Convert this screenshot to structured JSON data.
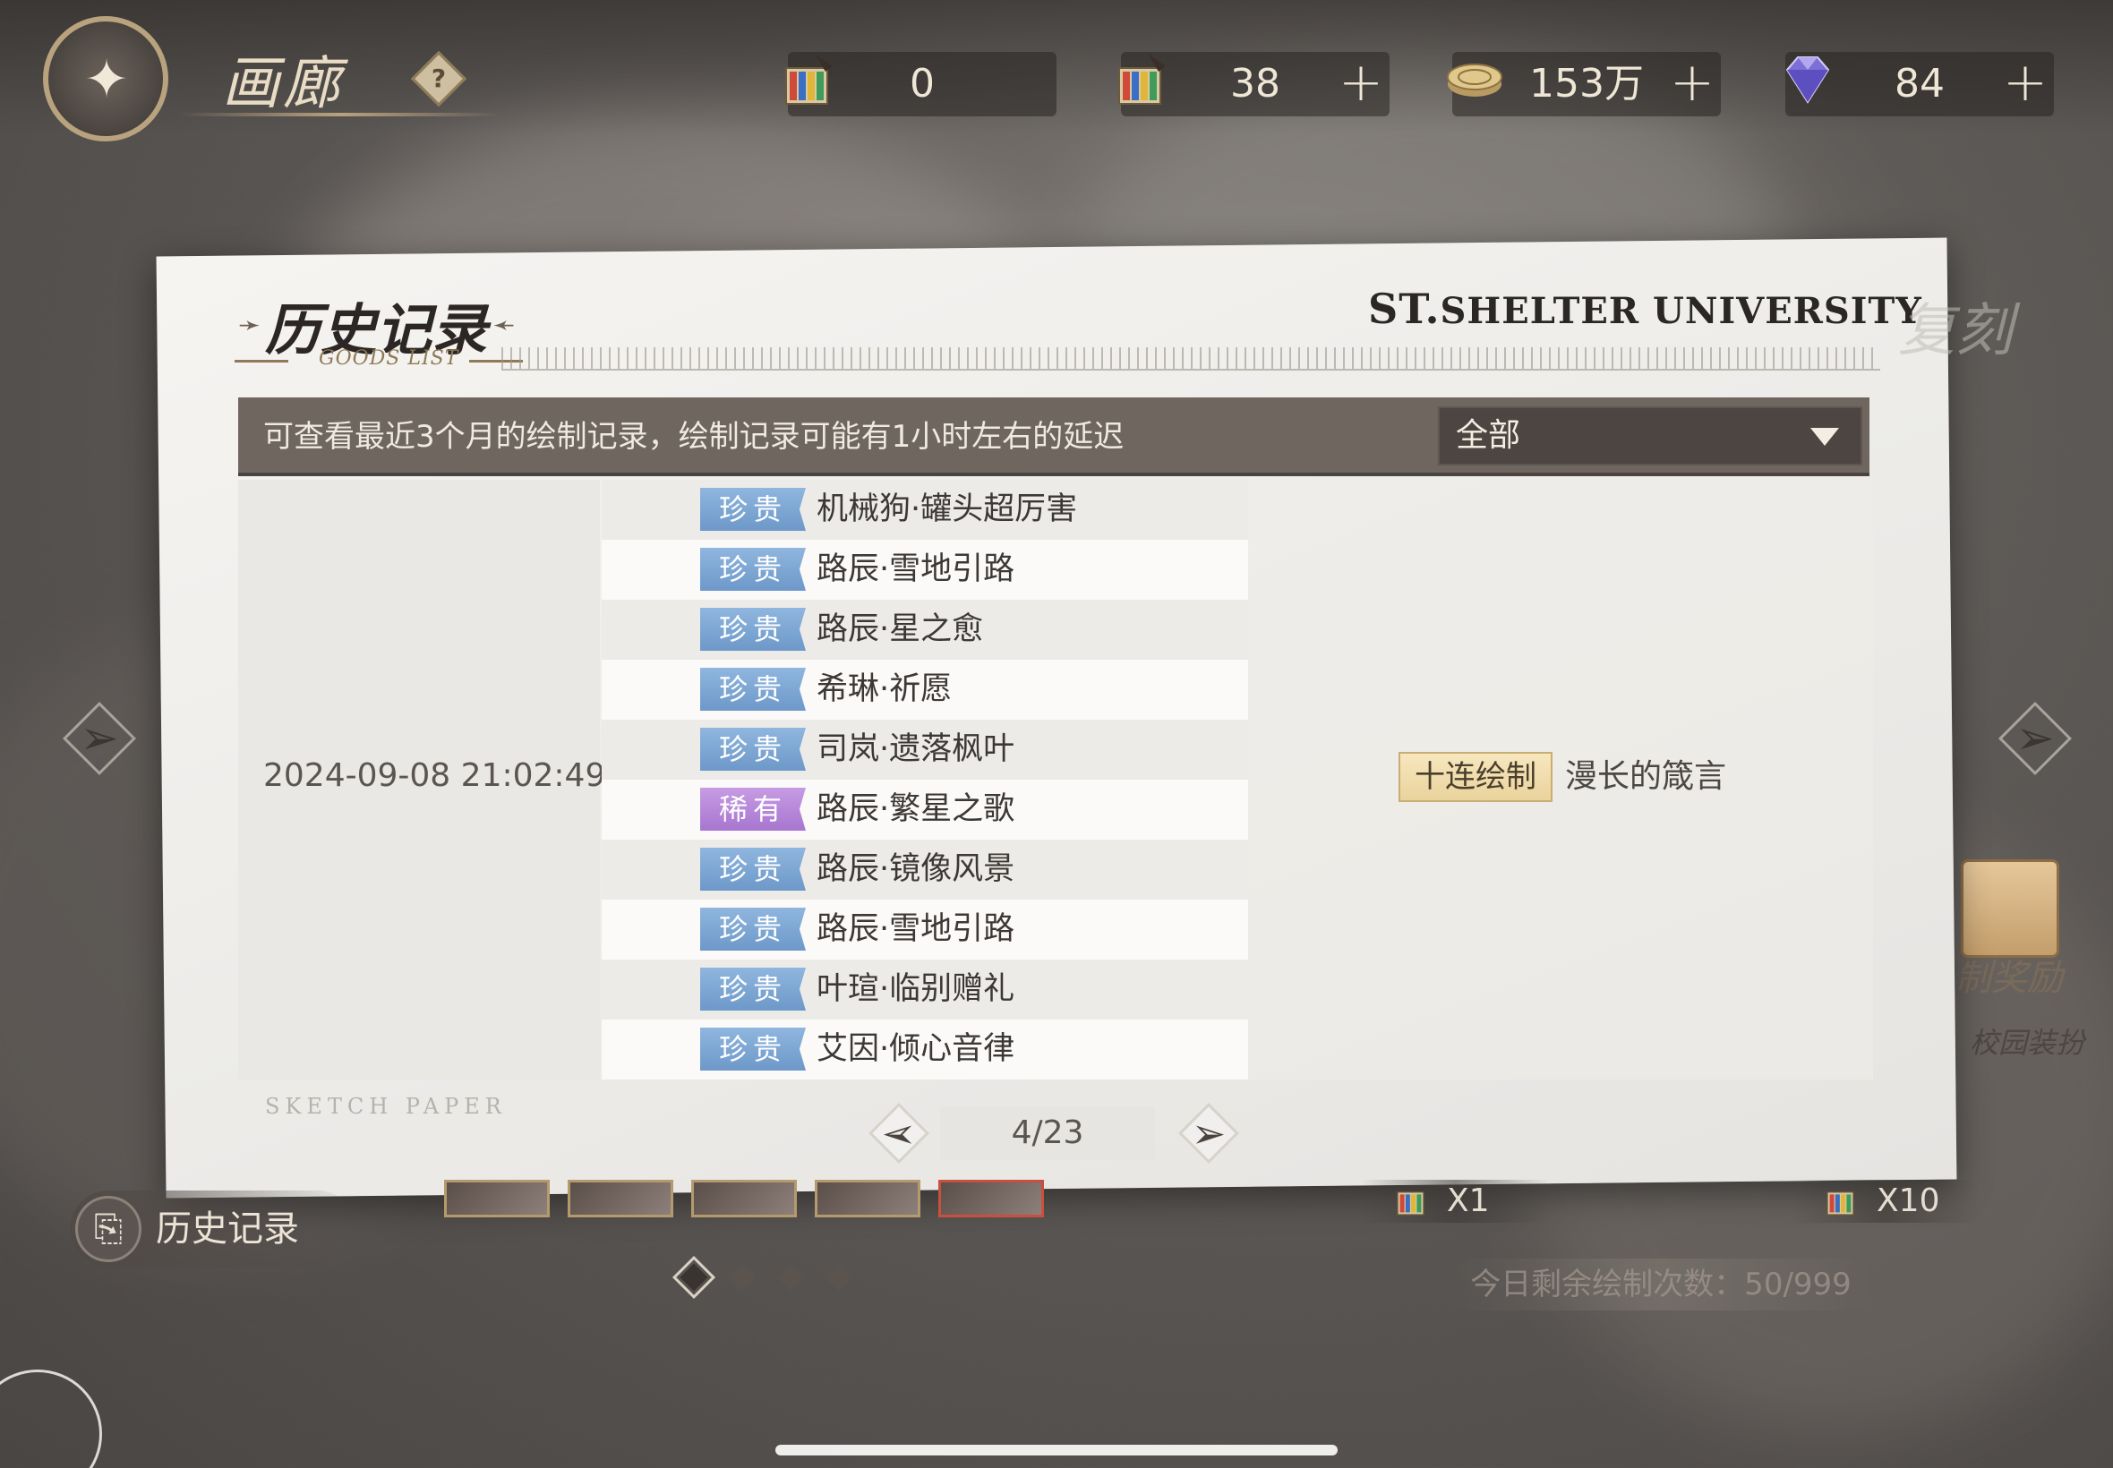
{
  "header": {
    "title": "画廊",
    "help_symbol": "?"
  },
  "resources": [
    {
      "icon": "paint-ticket-icon",
      "value": "0",
      "has_plus": false
    },
    {
      "icon": "paint-ticket-icon",
      "value": "38",
      "has_plus": true
    },
    {
      "icon": "coin-icon",
      "value": "153万",
      "has_plus": true
    },
    {
      "icon": "diamond-gem-icon",
      "value": "84",
      "has_plus": true
    }
  ],
  "modal": {
    "title": "历史记录",
    "subtitle": "GOODS LIST",
    "brand_prefix": "ST.",
    "brand": "SHELTER UNIVERSITY",
    "watermark": "复刻",
    "notice": "可查看最近3个月的绘制记录，绘制记录可能有1小时左右的延迟",
    "filter_value": "全部",
    "sketch_label": "SKETCH PAPER",
    "pagination": "4/23",
    "record": {
      "datetime": "2024-09-08  21:02:49",
      "draw_type": "十连绘制",
      "pool_name": "漫长的箴言",
      "items": [
        {
          "rarity": "珍贵",
          "name": "机械狗·罐头超厉害"
        },
        {
          "rarity": "珍贵",
          "name": "路辰·雪地引路"
        },
        {
          "rarity": "珍贵",
          "name": "路辰·星之愈"
        },
        {
          "rarity": "珍贵",
          "name": "希琳·祈愿"
        },
        {
          "rarity": "珍贵",
          "name": "司岚·遗落枫叶"
        },
        {
          "rarity": "稀有",
          "name": "路辰·繁星之歌"
        },
        {
          "rarity": "珍贵",
          "name": "路辰·镜像风景"
        },
        {
          "rarity": "珍贵",
          "name": "路辰·雪地引路"
        },
        {
          "rarity": "珍贵",
          "name": "叶瑄·临别赠礼"
        },
        {
          "rarity": "珍贵",
          "name": "艾因·倾心音律"
        }
      ]
    }
  },
  "footer": {
    "history_button": "历史记录",
    "draw_once": "X1",
    "draw_ten": "X10",
    "remaining": "今日剩余绘制次数：50/999",
    "reward_text1": "制奖励",
    "reward_text2": "校园装扮"
  },
  "colors": {
    "rarity_precious": "#7ea7d4",
    "rarity_rare": "#b586da",
    "info_bar": "#6f6660",
    "draw_tag": "#ead39c"
  }
}
